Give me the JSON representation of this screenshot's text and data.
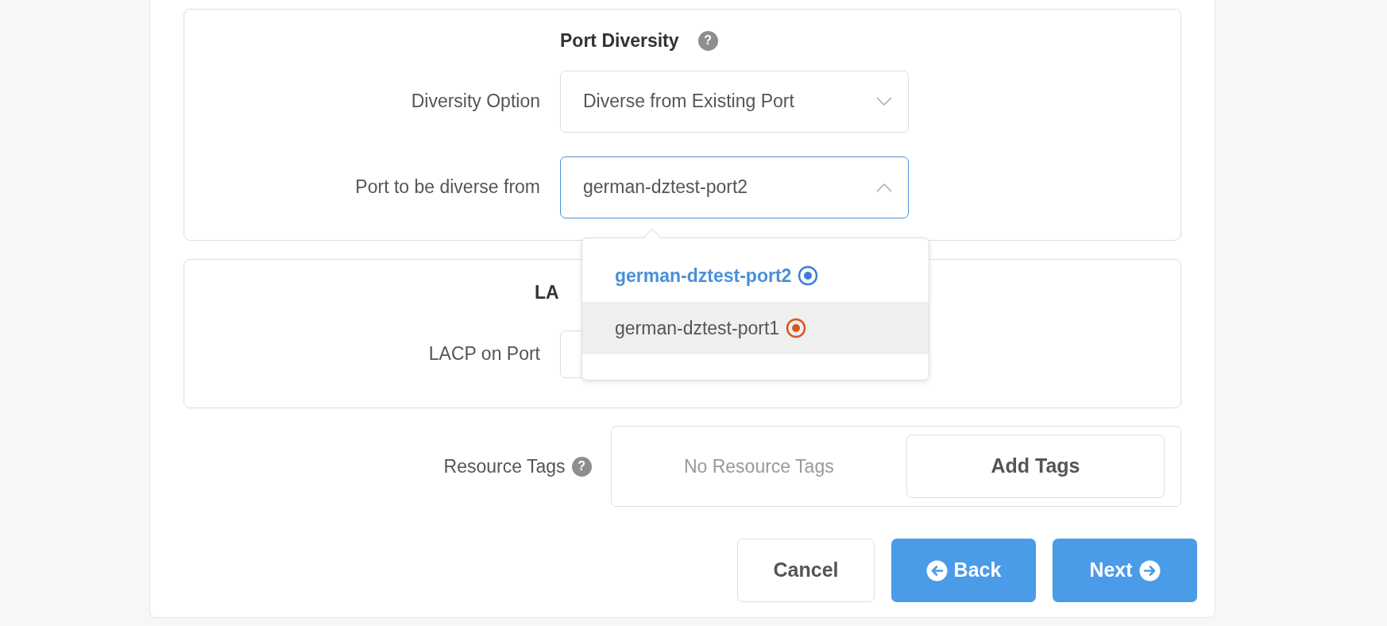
{
  "port_diversity": {
    "title": "Port Diversity",
    "help": "?",
    "fields": [
      {
        "label": "Diversity Option",
        "value": "Diverse from Existing Port",
        "expanded": false
      },
      {
        "label": "Port to be diverse from",
        "value": "german-dztest-port2",
        "expanded": true
      }
    ]
  },
  "dropdown": {
    "options": [
      {
        "label": "german-dztest-port2",
        "selected": true,
        "hovered": false,
        "color": "#3b7dd8"
      },
      {
        "label": "german-dztest-port1",
        "selected": false,
        "hovered": true,
        "color": "#d9541e"
      }
    ]
  },
  "lacp": {
    "title": "LA",
    "field_label": "LACP on Port"
  },
  "resource_tags": {
    "label": "Resource Tags",
    "help": "?",
    "empty_text": "No Resource Tags",
    "add_button": "Add Tags"
  },
  "buttons": [
    {
      "label": "Cancel",
      "kind": "cancel"
    },
    {
      "label": "Back",
      "kind": "back"
    },
    {
      "label": "Next",
      "kind": "next"
    }
  ]
}
